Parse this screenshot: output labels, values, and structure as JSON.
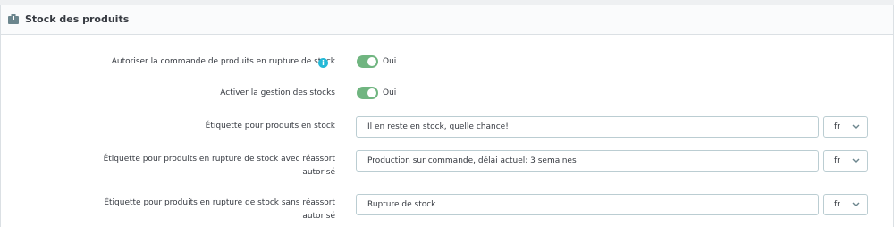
{
  "section": {
    "title": "Stock des produits",
    "icon": "box-icon"
  },
  "settings": {
    "allow_backorders": {
      "label": "Autoriser la commande de produits en rupture de stock",
      "info_icon": "info-icon",
      "value": "Oui",
      "enabled": true
    },
    "stock_management": {
      "label": "Activer la gestion des stocks",
      "value": "Oui",
      "enabled": true
    },
    "in_stock_label": {
      "label": "Étiquette pour produits en stock",
      "value": "Il en reste en stock, quelle chance!",
      "lang": "fr"
    },
    "backorder_allowed_label": {
      "label_line1": "Étiquette pour produits en rupture de stock avec réassort",
      "label_line2": "autorisé",
      "value": "Production sur commande, délai actuel: 3 semaines",
      "lang": "fr"
    },
    "backorder_denied_label": {
      "label_line1": "Étiquette pour produits en rupture de stock sans réassort",
      "label_line2": "autorisé",
      "value": "Rupture de stock",
      "lang": "fr"
    }
  },
  "colors": {
    "switch_on": "#70b580",
    "info": "#25b9d7",
    "input_border": "#bbcdd2"
  }
}
